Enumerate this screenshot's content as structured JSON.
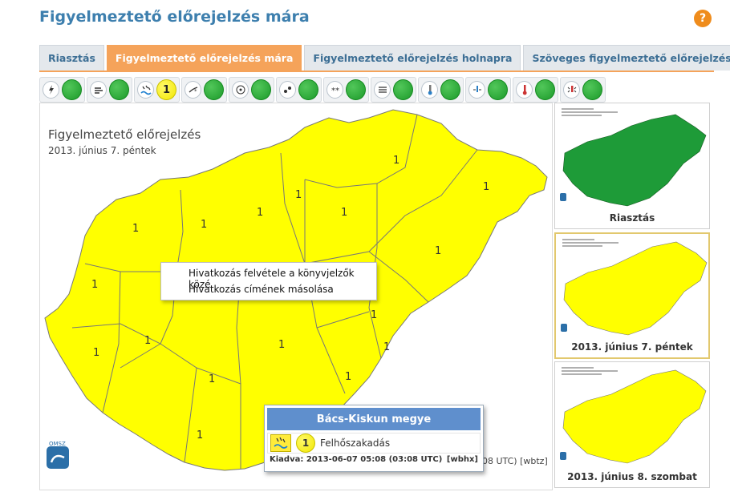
{
  "header": {
    "title": "Figyelmeztető előrejelzés mára",
    "help_label": "?"
  },
  "tabs": [
    {
      "label": "Riasztás",
      "active": false
    },
    {
      "label": "Figyelmeztető előrejelzés mára",
      "active": true
    },
    {
      "label": "Figyelmeztető előrejelzés holnapra",
      "active": false
    },
    {
      "label": "Szöveges figyelmeztető előrejelzés",
      "active": false
    }
  ],
  "hazard_buttons": [
    {
      "icon": "lightning-icon",
      "level": ""
    },
    {
      "icon": "wind-icon",
      "level": ""
    },
    {
      "icon": "cloudburst-icon",
      "level": "1"
    },
    {
      "icon": "snow-drift-icon",
      "level": ""
    },
    {
      "icon": "freezing-rain-icon",
      "level": ""
    },
    {
      "icon": "rain-icon",
      "level": ""
    },
    {
      "icon": "snow-icon",
      "level": ""
    },
    {
      "icon": "fog-icon",
      "level": ""
    },
    {
      "icon": "heat-thermometer-icon",
      "level": ""
    },
    {
      "icon": "cold-icon",
      "level": ""
    },
    {
      "icon": "cold-thermometer-icon",
      "level": ""
    },
    {
      "icon": "thaw-icon",
      "level": ""
    }
  ],
  "map": {
    "title": "Figyelmeztető előrejelzés",
    "date": "2013. június 7. péntek",
    "region_level": "1",
    "footnote": "08 UTC) [wbtz]",
    "logo_text": "OMSZ",
    "colors": {
      "yellow": "#ffff00",
      "green": "#1e9b38"
    }
  },
  "context_menu": {
    "items": [
      "Hivatkozás felvétele a könyvjelzők közé",
      "Hivatkozás címének másolása"
    ]
  },
  "tooltip": {
    "county": "Bács-Kiskun megye",
    "level": "1",
    "hazard": "Felhőszakadás",
    "issued": "Kiadva: 2013-06-07 05:08 (03:08 UTC)",
    "code": "[wbhx]"
  },
  "thumbnails": [
    {
      "caption": "Riasztás",
      "color": "green"
    },
    {
      "caption": "2013. június 7. péntek",
      "color": "yellow"
    },
    {
      "caption": "2013. június 8. szombat",
      "color": "yellow"
    }
  ]
}
